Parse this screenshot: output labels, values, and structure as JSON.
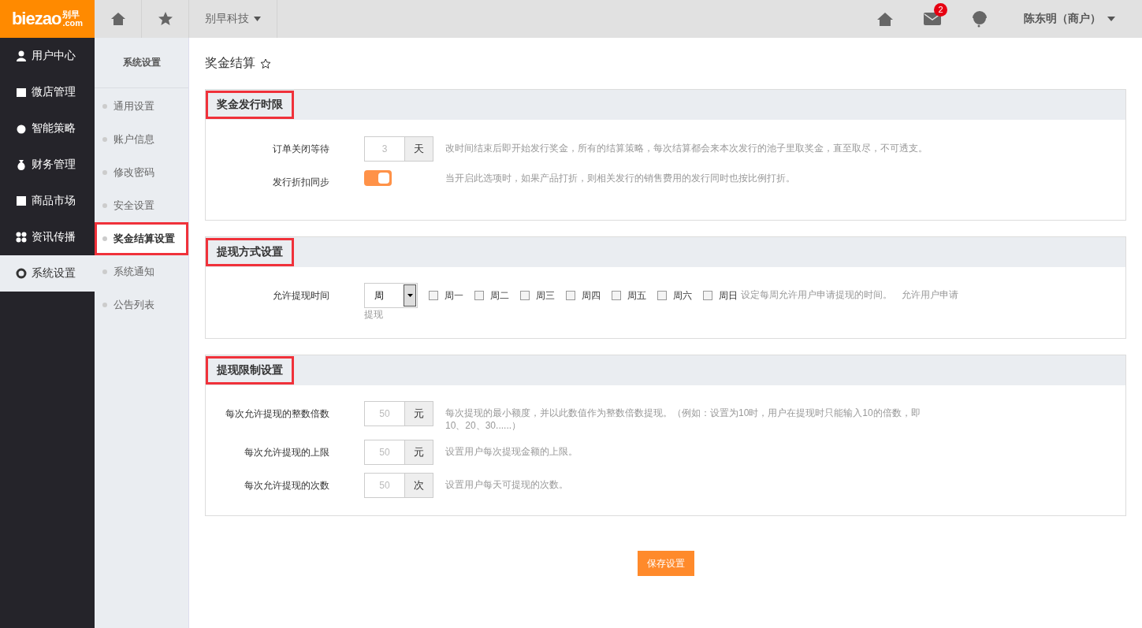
{
  "logo": {
    "text": "biezao",
    "cn": "别早",
    "domain": ".com"
  },
  "topbar": {
    "company": "别早科技",
    "mail_badge": "2",
    "user": "陈东明（商户）"
  },
  "sidebar": {
    "items": [
      {
        "label": "用户中心",
        "selected": false
      },
      {
        "label": "微店管理",
        "selected": false
      },
      {
        "label": "智能策略",
        "selected": false
      },
      {
        "label": "财务管理",
        "selected": false
      },
      {
        "label": "商品市场",
        "selected": false
      },
      {
        "label": "资讯传播",
        "selected": false
      },
      {
        "label": "系统设置",
        "selected": true
      }
    ]
  },
  "subnav": {
    "title": "系统设置",
    "items": [
      {
        "label": "通用设置",
        "selected": false,
        "highlighted": false
      },
      {
        "label": "账户信息",
        "selected": false,
        "highlighted": false
      },
      {
        "label": "修改密码",
        "selected": false,
        "highlighted": false
      },
      {
        "label": "安全设置",
        "selected": false,
        "highlighted": false
      },
      {
        "label": "奖金结算设置",
        "selected": true,
        "highlighted": true
      },
      {
        "label": "系统通知",
        "selected": false,
        "highlighted": false
      },
      {
        "label": "公告列表",
        "selected": false,
        "highlighted": false
      }
    ]
  },
  "page_title": "奖金结算",
  "sections": [
    {
      "title": "奖金发行时限",
      "highlighted": true,
      "rows": [
        {
          "kind": "input",
          "label": "订单关闭等待",
          "placeholder": "3",
          "unit": "天",
          "help": "改时间结束后即开始发行奖金，所有的结算策略，每次结算都会来本次发行的池子里取奖金，直至取尽，不可透支。"
        },
        {
          "kind": "toggle",
          "label": "发行折扣同步",
          "on": true,
          "help": "当开启此选项时，如果产品打折，则相关发行的销售费用的发行同时也按比例打折。"
        }
      ]
    },
    {
      "title": "提现方式设置",
      "highlighted": true,
      "rows": [
        {
          "kind": "schedule",
          "label": "允许提现时间",
          "select": "周",
          "days": [
            {
              "label": "周一",
              "checked": false
            },
            {
              "label": "周二",
              "checked": false
            },
            {
              "label": "周三",
              "checked": false
            },
            {
              "label": "周四",
              "checked": false
            },
            {
              "label": "周五",
              "checked": false
            },
            {
              "label": "周六",
              "checked": false
            },
            {
              "label": "周日",
              "checked": false
            }
          ],
          "help": "设定每周允许用户申请提现的时间。　允许用户申请",
          "help_continued": "提现"
        }
      ]
    },
    {
      "title": "提现限制设置",
      "highlighted": true,
      "rows": [
        {
          "kind": "input",
          "label": "每次允许提现的整数倍数",
          "placeholder": "50",
          "unit": "元",
          "help": "每次提现的最小额度，并以此数值作为整数倍数提现。（例如：设置为10时，用户在提现时只能输入10的倍数，即10、20、30......）"
        },
        {
          "kind": "input",
          "label": "每次允许提现的上限",
          "placeholder": "50",
          "unit": "元",
          "help": "设置用户每次提现金额的上限。"
        },
        {
          "kind": "input",
          "label": "每次允许提现的次数",
          "placeholder": "50",
          "unit": "次",
          "help": "设置用户每天可提现的次数。"
        }
      ]
    }
  ],
  "save_button": "保存设置"
}
